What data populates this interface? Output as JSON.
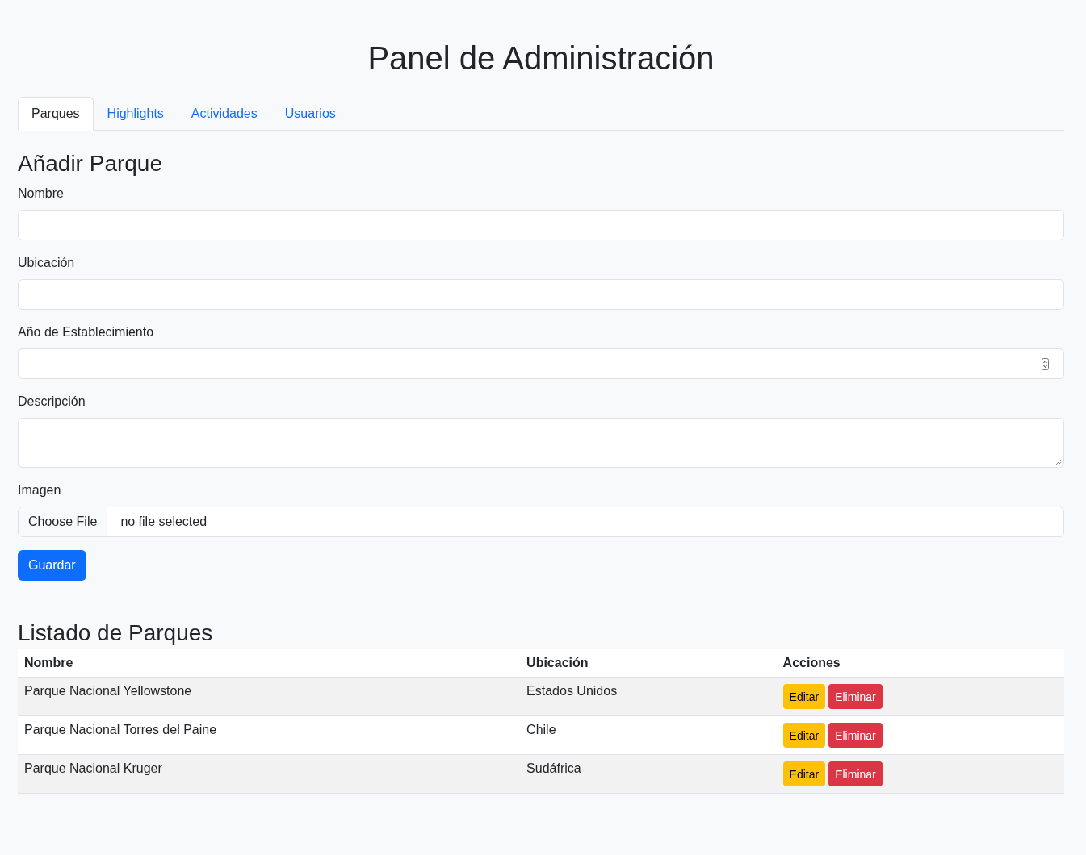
{
  "title": "Panel de Administración",
  "tabs": [
    {
      "label": "Parques",
      "selected": true
    },
    {
      "label": "Highlights",
      "selected": false
    },
    {
      "label": "Actividades",
      "selected": false
    },
    {
      "label": "Usuarios",
      "selected": false
    }
  ],
  "form": {
    "heading": "Añadir Parque",
    "fields": [
      {
        "kind": "text",
        "label": "Nombre"
      },
      {
        "kind": "text",
        "label": "Ubicación"
      },
      {
        "kind": "number",
        "label": "Año de Establecimiento"
      },
      {
        "kind": "textarea",
        "label": "Descripción"
      },
      {
        "kind": "file",
        "label": "Imagen",
        "button": "Choose File",
        "status": "no file selected"
      }
    ],
    "submit": "Guardar"
  },
  "list": {
    "heading": "Listado de Parques",
    "columns": [
      "Nombre",
      "Ubicación",
      "Acciones"
    ],
    "rows": [
      {
        "name": "Parque Nacional Yellowstone",
        "location": "Estados Unidos",
        "actions": [
          {
            "label": "Editar",
            "kind": "edit"
          },
          {
            "label": "Eliminar",
            "kind": "delete"
          }
        ]
      },
      {
        "name": "Parque Nacional Torres del Paine",
        "location": "Chile",
        "actions": [
          {
            "label": "Editar",
            "kind": "edit"
          },
          {
            "label": "Eliminar",
            "kind": "delete"
          }
        ]
      },
      {
        "name": "Parque Nacional Kruger",
        "location": "Sudáfrica",
        "actions": [
          {
            "label": "Editar",
            "kind": "edit"
          },
          {
            "label": "Eliminar",
            "kind": "delete"
          }
        ]
      }
    ]
  }
}
